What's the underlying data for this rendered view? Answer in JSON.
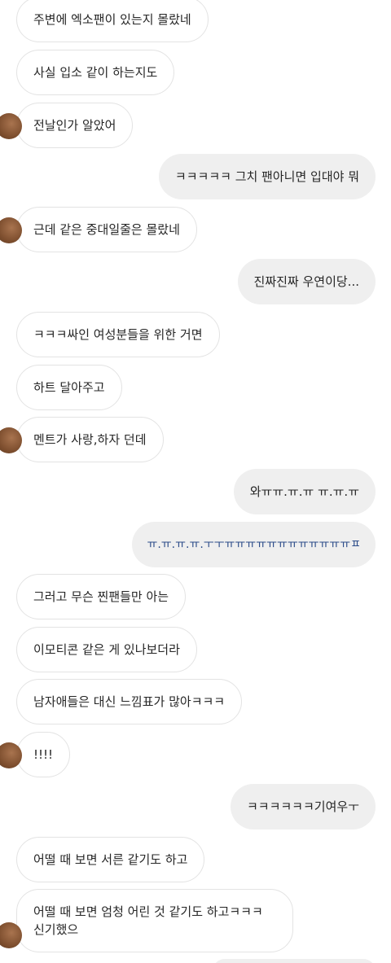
{
  "messages": [
    {
      "dir": "in",
      "text": "주변에 엑소팬이 있는지 몰랐네"
    },
    {
      "dir": "in",
      "text": "사실 입소 같이 하는지도"
    },
    {
      "dir": "in",
      "text": "전날인가 알았어"
    },
    {
      "dir": "out",
      "text": "ㅋㅋㅋㅋㅋ 그치 팬아니면 입대야 뭐"
    },
    {
      "dir": "in",
      "text": "근데 같은 중대일줄은 몰랐네"
    },
    {
      "dir": "out",
      "text": "진짜진짜 우연이당..."
    },
    {
      "dir": "in",
      "text": "ㅋㅋㅋ싸인 여성분들을 위한 거면"
    },
    {
      "dir": "in",
      "text": "하트 달아주고"
    },
    {
      "dir": "in",
      "text": "멘트가 사랑,하자 던데"
    },
    {
      "dir": "out",
      "text": "와ㅠㅠ.ㅠ.ㅠ ㅠ.ㅠ.ㅠ"
    },
    {
      "dir": "out",
      "text": "ㅠ.ㅠ.ㅠ.ㅠ.ㅜㅜㅠㅠㅠㅠㅠㅠㅠㅠㅠㅠㅠㅠㅍ"
    },
    {
      "dir": "in",
      "text": "그러고 무슨 찐팬들만 아는"
    },
    {
      "dir": "in",
      "text": "이모티콘 같은 게 있나보더라"
    },
    {
      "dir": "in",
      "text": "남자애들은 대신 느낌표가 많아ㅋㅋㅋ"
    },
    {
      "dir": "in",
      "text": "!!!!"
    },
    {
      "dir": "out",
      "text": "ㅋㅋㅋㅋㅋㅋ기여우ㅜ"
    },
    {
      "dir": "in",
      "text": "어떨 때 보면 서른 같기도 하고"
    },
    {
      "dir": "in",
      "text": "어떨 때 보면 엄청 어린 것 같기도 하고ㅋㅋㅋ 신기했으"
    }
  ]
}
